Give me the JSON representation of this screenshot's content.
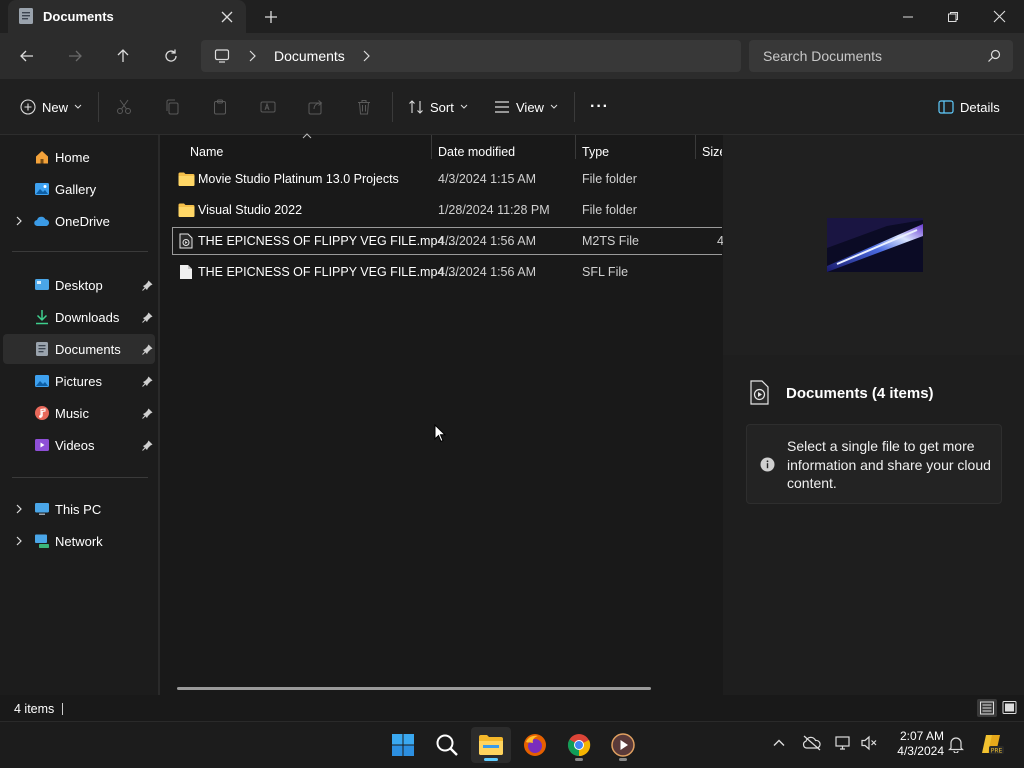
{
  "window": {
    "tab_title": "Documents",
    "tab_icon": "documents-folder-icon",
    "new_tab_icon": "plus-icon",
    "minimize_icon": "minimize-icon",
    "maximize_icon": "restore-icon",
    "close_icon": "close-icon"
  },
  "nav": {
    "back_icon": "arrow-left-icon",
    "forward_icon": "arrow-right-icon",
    "up_icon": "arrow-up-icon",
    "refresh_icon": "refresh-icon"
  },
  "address": {
    "root_icon": "monitor-icon",
    "crumbs": [
      "Documents"
    ]
  },
  "search": {
    "placeholder": "Search Documents"
  },
  "toolbar": {
    "new_label": "New",
    "sort_label": "Sort",
    "view_label": "View",
    "more_label": "···",
    "details_label": "Details",
    "disabled_icons": [
      "cut-icon",
      "copy-icon",
      "paste-icon",
      "rename-icon",
      "share-icon",
      "delete-icon"
    ]
  },
  "sidebar": {
    "top": [
      {
        "label": "Home",
        "icon": "home-icon"
      },
      {
        "label": "Gallery",
        "icon": "gallery-icon"
      },
      {
        "label": "OneDrive",
        "icon": "onedrive-icon",
        "expandable": true
      }
    ],
    "pinned": [
      {
        "label": "Desktop",
        "icon": "desktop-icon"
      },
      {
        "label": "Downloads",
        "icon": "downloads-icon"
      },
      {
        "label": "Documents",
        "icon": "documents-icon",
        "selected": true
      },
      {
        "label": "Pictures",
        "icon": "pictures-icon"
      },
      {
        "label": "Music",
        "icon": "music-icon"
      },
      {
        "label": "Videos",
        "icon": "videos-icon"
      }
    ],
    "bottom": [
      {
        "label": "This PC",
        "icon": "this-pc-icon"
      },
      {
        "label": "Network",
        "icon": "network-icon"
      }
    ]
  },
  "columns": [
    "Name",
    "Date modified",
    "Type",
    "Size"
  ],
  "files": [
    {
      "name": "Movie Studio Platinum 13.0 Projects",
      "date": "4/3/2024 1:15 AM",
      "type": "File folder",
      "size": "",
      "icon": "folder-icon"
    },
    {
      "name": "Visual Studio 2022",
      "date": "1/28/2024 11:28 PM",
      "type": "File folder",
      "size": "",
      "icon": "folder-icon"
    },
    {
      "name": "THE EPICNESS OF FLIPPY VEG FILE.mp4....",
      "date": "4/3/2024 1:56 AM",
      "type": "M2TS File",
      "size": "4",
      "icon": "video-file-icon"
    },
    {
      "name": "THE EPICNESS OF FLIPPY VEG FILE.mp4....",
      "date": "4/3/2024 1:56 AM",
      "type": "SFL File",
      "size": "",
      "icon": "file-icon"
    }
  ],
  "details_pane": {
    "title": "Documents (4 items)",
    "info_text": "Select a single file to get more information and share your cloud content."
  },
  "status": {
    "items_text": "4 items"
  },
  "taskbar": {
    "apps": [
      "start-icon",
      "search-icon",
      "file-explorer-icon",
      "firefox-icon",
      "chrome-icon",
      "media-player-icon"
    ],
    "time": "2:07 AM",
    "date": "4/3/2024"
  }
}
